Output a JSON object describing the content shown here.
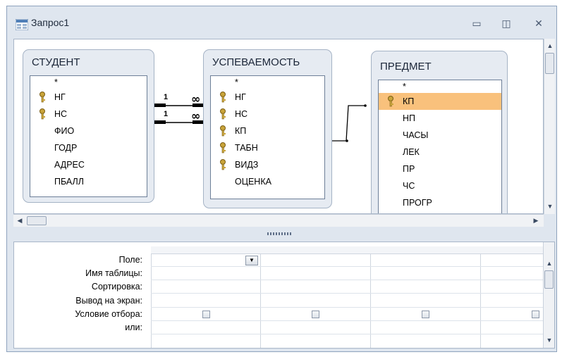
{
  "window": {
    "title": "Запрос1",
    "controls": {
      "minimize": "▭",
      "restore": "◫",
      "close": "✕"
    }
  },
  "tables": [
    {
      "title": "СТУДЕНТ",
      "fields": [
        {
          "name": "*",
          "key": false,
          "selected": false
        },
        {
          "name": "НГ",
          "key": true,
          "selected": false
        },
        {
          "name": "НС",
          "key": true,
          "selected": false
        },
        {
          "name": "ФИО",
          "key": false,
          "selected": false
        },
        {
          "name": "ГОДР",
          "key": false,
          "selected": false
        },
        {
          "name": "АДРЕС",
          "key": false,
          "selected": false
        },
        {
          "name": "ПБАЛЛ",
          "key": false,
          "selected": false
        }
      ]
    },
    {
      "title": "УСПЕВАЕМОСТЬ",
      "fields": [
        {
          "name": "*",
          "key": false,
          "selected": false
        },
        {
          "name": "НГ",
          "key": true,
          "selected": false
        },
        {
          "name": "НС",
          "key": true,
          "selected": false
        },
        {
          "name": "КП",
          "key": true,
          "selected": false
        },
        {
          "name": "ТАБН",
          "key": true,
          "selected": false
        },
        {
          "name": "ВИДЗ",
          "key": true,
          "selected": false
        },
        {
          "name": "ОЦЕНКА",
          "key": false,
          "selected": false
        }
      ]
    },
    {
      "title": "ПРЕДМЕТ",
      "fields": [
        {
          "name": "*",
          "key": false,
          "selected": false
        },
        {
          "name": "КП",
          "key": true,
          "selected": true
        },
        {
          "name": "НП",
          "key": false,
          "selected": false
        },
        {
          "name": "ЧАСЫ",
          "key": false,
          "selected": false
        },
        {
          "name": "ЛЕК",
          "key": false,
          "selected": false
        },
        {
          "name": "ПР",
          "key": false,
          "selected": false
        },
        {
          "name": "ЧС",
          "key": false,
          "selected": false
        },
        {
          "name": "ПРОГР",
          "key": false,
          "selected": false
        }
      ]
    }
  ],
  "relations": {
    "one": "1",
    "many": "∞"
  },
  "grid": {
    "rows": [
      "Поле:",
      "Имя таблицы:",
      "Сортировка:",
      "Вывод на экран:",
      "Условие отбора:",
      "или:"
    ],
    "columns": 4
  },
  "colors": {
    "selection": "#f9c17c",
    "key_icon": "#c9a43a",
    "panel": "#e6ebf2"
  }
}
